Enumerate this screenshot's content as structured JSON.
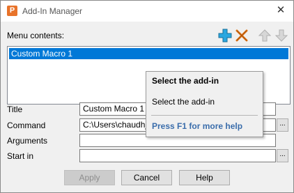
{
  "window": {
    "title": "Add-In Manager",
    "app_icon_letter": "P",
    "close_glyph": "✕"
  },
  "menu": {
    "label": "Menu contents:",
    "toolbar_icons": [
      "add-icon",
      "delete-icon",
      "move-up-icon",
      "move-down-icon"
    ],
    "items": [
      "Custom Macro 1"
    ],
    "selected_index": 0
  },
  "form": {
    "title": {
      "label": "Title",
      "value": "Custom Macro 1"
    },
    "command": {
      "label": "Command",
      "value": "C:\\Users\\chaudhj"
    },
    "arguments": {
      "label": "Arguments",
      "value": ""
    },
    "start_in": {
      "label": "Start in",
      "value": ""
    },
    "browse_label": "..."
  },
  "tooltip": {
    "title": "Select the add-in",
    "body": "Select the add-in",
    "help": "Press F1 for more help"
  },
  "buttons": {
    "apply": "Apply",
    "cancel": "Cancel",
    "help": "Help"
  },
  "colors": {
    "selection": "#0078d7",
    "add_icon": "#2ba7e0",
    "delete_icon": "#e27a1f",
    "tooltip_help": "#3a6dab"
  }
}
